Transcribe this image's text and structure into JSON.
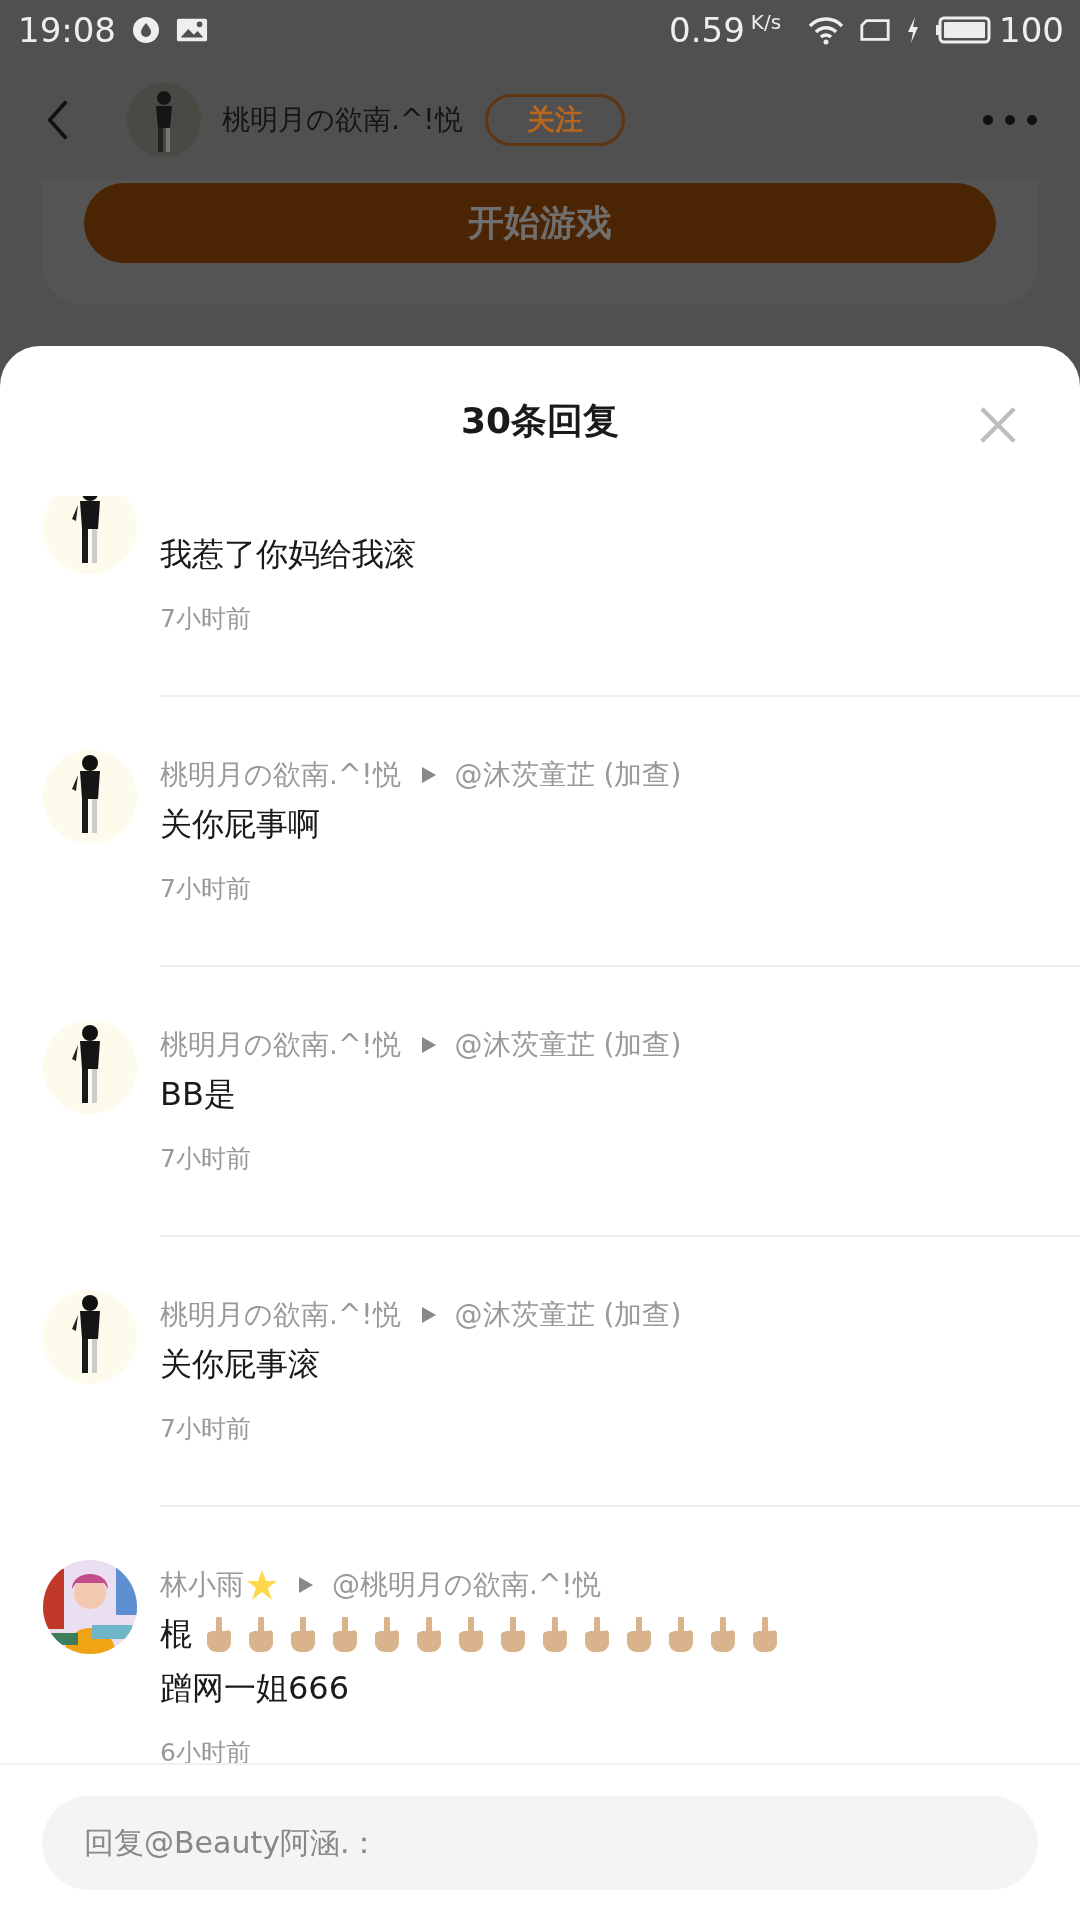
{
  "status_bar": {
    "time": "19:08",
    "speed": "0.59",
    "speed_unit": "K/s",
    "battery": "100"
  },
  "header": {
    "username": "桃明月の欲南.^!悦",
    "follow": "关注"
  },
  "card": {
    "button": "开始游戏"
  },
  "sheet": {
    "title": "30条回复",
    "comments": [
      {
        "avatar": {
          "kind": "sketch"
        },
        "lines": [
          {
            "text": "我惹了你妈给我滚"
          }
        ],
        "time": "7小时前"
      },
      {
        "avatar": {
          "kind": "sketch"
        },
        "author": "桃明月の欲南.^!悦",
        "reply_to": "@沐茨童芷 (加查)",
        "lines": [
          {
            "text": "关你屁事啊"
          }
        ],
        "time": "7小时前"
      },
      {
        "avatar": {
          "kind": "sketch"
        },
        "author": "桃明月の欲南.^!悦",
        "reply_to": "@沐茨童芷 (加查)",
        "lines": [
          {
            "text": "BB是"
          }
        ],
        "time": "7小时前"
      },
      {
        "avatar": {
          "kind": "sketch"
        },
        "author": "桃明月の欲南.^!悦",
        "reply_to": "@沐茨童芷 (加查)",
        "lines": [
          {
            "text": "关你屁事滚"
          }
        ],
        "time": "7小时前"
      },
      {
        "avatar": {
          "kind": "colorful"
        },
        "author": "林小雨",
        "author_emoji": {
          "kind": "star"
        },
        "reply_to": "@桃明月の欲南.^!悦",
        "lines": [
          {
            "text": "棍",
            "emojis": [
              {
                "kind": "middle-finger"
              },
              {
                "kind": "middle-finger"
              },
              {
                "kind": "middle-finger"
              },
              {
                "kind": "middle-finger"
              },
              {
                "kind": "middle-finger"
              },
              {
                "kind": "middle-finger"
              },
              {
                "kind": "middle-finger"
              },
              {
                "kind": "middle-finger"
              },
              {
                "kind": "middle-finger"
              },
              {
                "kind": "middle-finger"
              },
              {
                "kind": "middle-finger"
              },
              {
                "kind": "middle-finger"
              },
              {
                "kind": "middle-finger"
              },
              {
                "kind": "middle-finger"
              }
            ]
          },
          {
            "text": "蹭网一姐666"
          }
        ],
        "time": "6小时前"
      }
    ]
  },
  "reply_field": {
    "placeholder": "回复@Beauty阿涵.："
  }
}
